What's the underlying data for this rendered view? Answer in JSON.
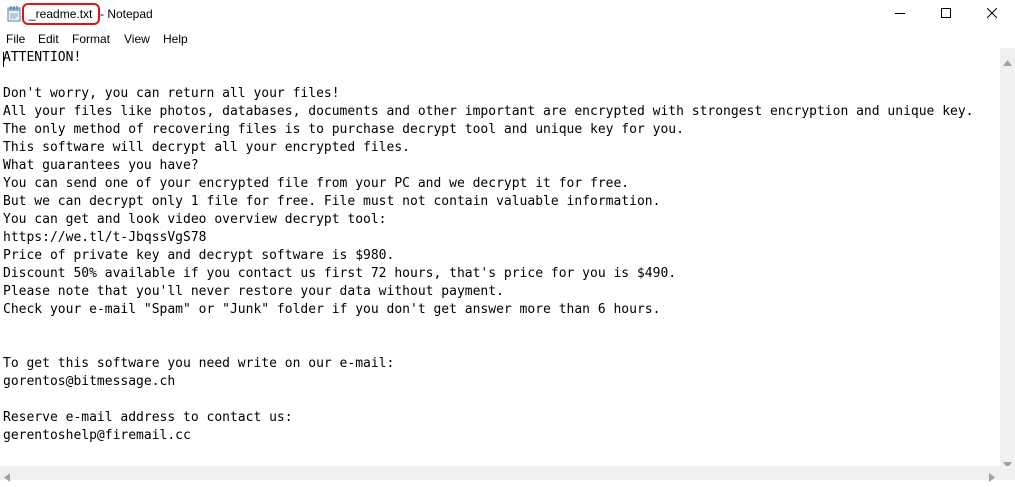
{
  "window": {
    "filename": "_readme.txt",
    "app_suffix": "- Notepad"
  },
  "menu": [
    "File",
    "Edit",
    "Format",
    "View",
    "Help"
  ],
  "editor": {
    "lines": [
      "ATTENTION!",
      "",
      "Don't worry, you can return all your files!",
      "All your files like photos, databases, documents and other important are encrypted with strongest encryption and unique key.",
      "The only method of recovering files is to purchase decrypt tool and unique key for you.",
      "This software will decrypt all your encrypted files.",
      "What guarantees you have?",
      "You can send one of your encrypted file from your PC and we decrypt it for free.",
      "But we can decrypt only 1 file for free. File must not contain valuable information.",
      "You can get and look video overview decrypt tool:",
      "https://we.tl/t-JbqssVgS78",
      "Price of private key and decrypt software is $980.",
      "Discount 50% available if you contact us first 72 hours, that's price for you is $490.",
      "Please note that you'll never restore your data without payment.",
      "Check your e-mail \"Spam\" or \"Junk\" folder if you don't get answer more than 6 hours.",
      "",
      "",
      "To get this software you need write on our e-mail:",
      "gorentos@bitmessage.ch",
      "",
      "Reserve e-mail address to contact us:",
      "gerentoshelp@firemail.cc"
    ]
  },
  "colors": {
    "highlight_border": "#e0141e",
    "chrome_bg": "#f0f0f0",
    "text": "#000000"
  },
  "icons": [
    "notepad-icon",
    "minimize-icon",
    "maximize-icon",
    "close-icon"
  ]
}
